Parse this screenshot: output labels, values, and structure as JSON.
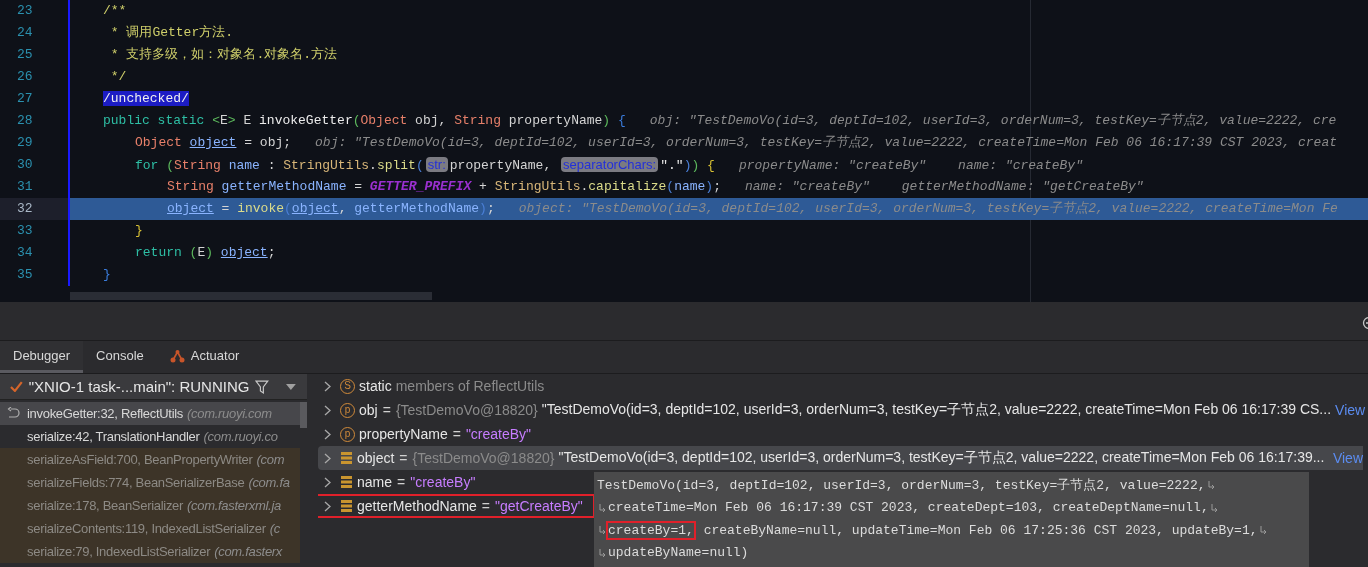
{
  "editor": {
    "lines": [
      {
        "number": "23",
        "current": false,
        "tokens": [
          {
            "kind": "comment",
            "text": "/**"
          }
        ]
      },
      {
        "number": "24",
        "current": false,
        "tokens": [
          {
            "kind": "comment",
            "text": " * 调用Getter方法."
          }
        ]
      },
      {
        "number": "25",
        "current": false,
        "tokens": [
          {
            "kind": "comment",
            "text": " * 支持多级，如：对象名.对象名.方法"
          }
        ]
      },
      {
        "number": "26",
        "current": false,
        "tokens": [
          {
            "kind": "comment",
            "text": " */"
          }
        ]
      },
      {
        "number": "27",
        "current": false,
        "tokens": [
          {
            "kind": "selection",
            "text": "/unchecked/"
          }
        ]
      },
      {
        "number": "28",
        "current": false,
        "tokens": [
          {
            "kind": "kw",
            "text": "public static "
          },
          {
            "kind": "paren",
            "text": "<"
          },
          {
            "kind": "plain",
            "text": "E"
          },
          {
            "kind": "paren",
            "text": ">"
          },
          {
            "kind": "plain",
            "text": " E "
          },
          {
            "kind": "decl",
            "text": "invokeGetter"
          },
          {
            "kind": "paren",
            "text": "("
          },
          {
            "kind": "type",
            "text": "Object"
          },
          {
            "kind": "plain",
            "text": " obj, "
          },
          {
            "kind": "type",
            "text": "String"
          },
          {
            "kind": "plain",
            "text": " propertyName"
          },
          {
            "kind": "paren",
            "text": ")"
          },
          {
            "kind": "brace1",
            "text": " {"
          },
          {
            "kind": "hint",
            "text": "obj: \"TestDemoVo(id=3, deptId=102, userId=3, orderNum=3, testKey=子节点2, value=2222, cre"
          }
        ],
        "children": [
          {
            "number": "29",
            "current": false,
            "tokens": [
              {
                "kind": "type",
                "text": "Object "
              },
              {
                "kind": "field",
                "text": "object"
              },
              {
                "kind": "plain",
                "text": " = obj;"
              },
              {
                "kind": "hint",
                "text": "obj: \"TestDemoVo(id=3, deptId=102, userId=3, orderNum=3, testKey=子节点2, value=2222, createTime=Mon Feb 06 16:17:39 CST 2023, creat"
              }
            ]
          },
          {
            "number": "30",
            "current": false,
            "tokens": [
              {
                "kind": "kw",
                "text": "for "
              },
              {
                "kind": "paren",
                "text": "("
              },
              {
                "kind": "type",
                "text": "String "
              },
              {
                "kind": "local",
                "text": "name"
              },
              {
                "kind": "plain",
                "text": " : "
              },
              {
                "kind": "cls",
                "text": "StringUtils"
              },
              {
                "kind": "plain",
                "text": "."
              },
              {
                "kind": "method",
                "text": "split"
              },
              {
                "kind": "paren2",
                "text": "("
              },
              {
                "kind": "badge",
                "text": "str:"
              },
              {
                "kind": "plain",
                "text": "propertyName, "
              },
              {
                "kind": "badge",
                "text": "separatorChars:"
              },
              {
                "kind": "string",
                "text": "\".\""
              },
              {
                "kind": "paren2",
                "text": ")"
              },
              {
                "kind": "paren",
                "text": ")"
              },
              {
                "kind": "brace2",
                "text": " {"
              },
              {
                "kind": "hint",
                "text": "propertyName: \"createBy\""
              },
              {
                "kind": "hint",
                "text": "name: \"createBy\""
              }
            ],
            "children": [
              {
                "number": "31",
                "current": false,
                "tokens": [
                  {
                    "kind": "type",
                    "text": "String "
                  },
                  {
                    "kind": "local",
                    "text": "getterMethodName"
                  },
                  {
                    "kind": "plain",
                    "text": " = "
                  },
                  {
                    "kind": "const",
                    "text": "GETTER_PREFIX"
                  },
                  {
                    "kind": "plain",
                    "text": " + "
                  },
                  {
                    "kind": "cls",
                    "text": "StringUtils"
                  },
                  {
                    "kind": "plain",
                    "text": "."
                  },
                  {
                    "kind": "method",
                    "text": "capitalize"
                  },
                  {
                    "kind": "paren2",
                    "text": "("
                  },
                  {
                    "kind": "local",
                    "text": "name"
                  },
                  {
                    "kind": "paren2",
                    "text": ")"
                  },
                  {
                    "kind": "plain",
                    "text": ";"
                  },
                  {
                    "kind": "hint",
                    "text": "name: \"createBy\""
                  },
                  {
                    "kind": "hint",
                    "text": "getterMethodName: \"getCreateBy\""
                  }
                ]
              },
              {
                "number": "32",
                "current": true,
                "tokens": [
                  {
                    "kind": "field",
                    "text": "object"
                  },
                  {
                    "kind": "plain",
                    "text": " = "
                  },
                  {
                    "kind": "method",
                    "text": "invoke"
                  },
                  {
                    "kind": "paren2",
                    "text": "("
                  },
                  {
                    "kind": "field",
                    "text": "object"
                  },
                  {
                    "kind": "plain",
                    "text": ", "
                  },
                  {
                    "kind": "local",
                    "text": "getterMethodName"
                  },
                  {
                    "kind": "paren2",
                    "text": ")"
                  },
                  {
                    "kind": "plain",
                    "text": ";"
                  },
                  {
                    "kind": "hint",
                    "text": "object: \"TestDemoVo(id=3, deptId=102, userId=3, orderNum=3, testKey=子节点2, value=2222, createTime=Mon Fe"
                  }
                ]
              }
            ]
          },
          {
            "number": "33",
            "current": false,
            "tokens": [
              {
                "kind": "brace2",
                "text": "}"
              }
            ]
          },
          {
            "number": "34",
            "current": false,
            "tokens": [
              {
                "kind": "kw",
                "text": "return "
              },
              {
                "kind": "paren",
                "text": "("
              },
              {
                "kind": "plain",
                "text": "E"
              },
              {
                "kind": "paren",
                "text": ") "
              },
              {
                "kind": "field",
                "text": "object"
              },
              {
                "kind": "plain",
                "text": ";"
              }
            ]
          }
        ]
      },
      {
        "number": "35",
        "current": false,
        "tokens": [
          {
            "kind": "brace1",
            "text": "}"
          }
        ]
      }
    ]
  },
  "tabs": [
    {
      "label": "Debugger",
      "selected": true,
      "kind": "plain"
    },
    {
      "label": "Console",
      "selected": false,
      "kind": "plain"
    },
    {
      "label": "Actuator",
      "selected": false,
      "kind": "plugin"
    }
  ],
  "thread": {
    "text": "\"XNIO-1 task-...main\": RUNNING"
  },
  "frames": [
    {
      "method": "invokeGetter:32, ReflectUtils",
      "package": "(com.ruoyi.com",
      "selected": true,
      "kind": "project"
    },
    {
      "method": "serialize:42, TranslationHandler",
      "package": "(com.ruoyi.co",
      "selected": false,
      "kind": "project"
    },
    {
      "method": "serializeAsField:700, BeanPropertyWriter",
      "package": "(com",
      "selected": false,
      "kind": "library"
    },
    {
      "method": "serializeFields:774, BeanSerializerBase",
      "package": "(com.fa",
      "selected": false,
      "kind": "library"
    },
    {
      "method": "serialize:178, BeanSerializer",
      "package": "(com.fasterxml.ja",
      "selected": false,
      "kind": "library"
    },
    {
      "method": "serializeContents:119, IndexedListSerializer",
      "package": "(c",
      "selected": false,
      "kind": "library"
    },
    {
      "method": "serialize:79, IndexedListSerializer",
      "package": "(com.fasterx",
      "selected": false,
      "kind": "library"
    }
  ],
  "variables": [
    {
      "kind": "static",
      "icon_letter": "S",
      "name": "static",
      "value": "members of ReflectUtils",
      "selected": false,
      "annotated": false
    },
    {
      "kind": "param",
      "icon_letter": "p",
      "name": "obj",
      "separator": "=",
      "type_ref": "{TestDemoVo@18820}",
      "value": "\"TestDemoVo(id=3, deptId=102, userId=3, orderNum=3, testKey=子节点2, value=2222, createTime=Mon Feb 06 16:17:39 CS...",
      "is_string": false,
      "link": "View",
      "selected": false,
      "annotated": false
    },
    {
      "kind": "param",
      "icon_letter": "p",
      "name": "propertyName",
      "separator": "=",
      "value": "\"createBy\"",
      "is_string": true,
      "selected": false,
      "annotated": false
    },
    {
      "kind": "local",
      "name": "object",
      "separator": "=",
      "type_ref": "{TestDemoVo@18820}",
      "value": "\"TestDemoVo(id=3, deptId=102, userId=3, orderNum=3, testKey=子节点2, value=2222, createTime=Mon Feb 06 16:17:39...",
      "is_string": false,
      "link": "View",
      "selected": true,
      "annotated": false
    },
    {
      "kind": "local",
      "name": "name",
      "separator": "=",
      "value": "\"createBy\"",
      "is_string": true,
      "selected": false,
      "annotated": false
    },
    {
      "kind": "local",
      "name": "getterMethodName",
      "separator": "=",
      "value": "\"getCreateBy\"",
      "is_string": true,
      "selected": false,
      "annotated": true
    }
  ],
  "tooltip": {
    "lines": [
      {
        "continued": false,
        "wrapped": true,
        "segments": [
          {
            "text": "TestDemoVo(id=3, deptId=102, userId=3, orderNum=3, testKey=子节点2, value=2222,",
            "annotated": false
          }
        ]
      },
      {
        "continued": true,
        "wrapped": true,
        "segments": [
          {
            "text": "createTime=Mon Feb 06 16:17:39 CST 2023, createDept=103, createDeptName=null,",
            "annotated": false
          }
        ]
      },
      {
        "continued": true,
        "wrapped": true,
        "segments": [
          {
            "text": "createBy=1,",
            "annotated": true
          },
          {
            "text": "createByName=null, updateTime=Mon Feb 06 17:25:36 CST 2023, updateBy=1,",
            "annotated": false
          }
        ]
      },
      {
        "continued": true,
        "wrapped": false,
        "segments": [
          {
            "text": "updateByName=null)",
            "annotated": false
          }
        ]
      }
    ]
  }
}
